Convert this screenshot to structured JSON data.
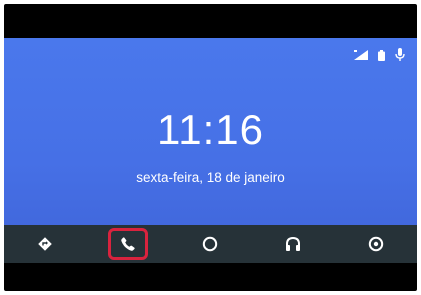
{
  "status": {
    "icons": [
      "signal-icon",
      "battery-icon",
      "microphone-icon"
    ]
  },
  "home": {
    "time": "11:16",
    "date": "sexta-feira, 18 de janeiro"
  },
  "navbar": {
    "items": [
      {
        "name": "navigation-icon"
      },
      {
        "name": "phone-icon",
        "highlighted": true
      },
      {
        "name": "home-icon"
      },
      {
        "name": "headphones-icon"
      },
      {
        "name": "recent-icon"
      }
    ]
  },
  "colors": {
    "screen_bg": "#4670e6",
    "navbar_bg": "#263238",
    "highlight_border": "#d9233e",
    "text": "#ffffff"
  }
}
